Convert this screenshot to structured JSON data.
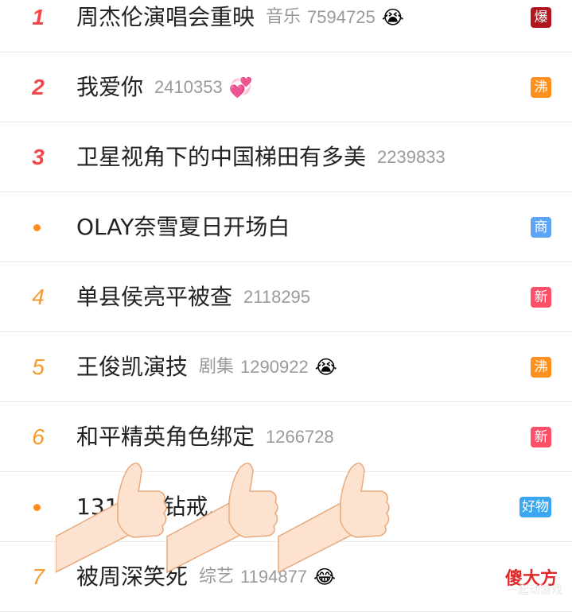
{
  "items": [
    {
      "rank": "1",
      "title": "周杰伦演唱会重映",
      "category": "音乐",
      "count": "7594725",
      "emoji": "😭",
      "badge": "爆",
      "badge_color": "#b2151d"
    },
    {
      "rank": "2",
      "title": "我爱你",
      "category": "",
      "count": "2410353",
      "emoji": "💞",
      "badge": "沸",
      "badge_color": "#ff8f1f"
    },
    {
      "rank": "3",
      "title": "卫星视角下的中国梯田有多美",
      "category": "",
      "count": "2239833",
      "emoji": "",
      "badge": "",
      "badge_color": ""
    },
    {
      "rank": "",
      "title": "OLAY奈雪夏日开场白",
      "category": "",
      "count": "",
      "emoji": "",
      "badge": "商",
      "badge_color": "#5ea4f5"
    },
    {
      "rank": "4",
      "title": "单县侯亮平被查",
      "category": "",
      "count": "2118295",
      "emoji": "",
      "badge": "新",
      "badge_color": "#ff4e6a"
    },
    {
      "rank": "5",
      "title": "王俊凯演技",
      "category": "剧集",
      "count": "1290922",
      "emoji": "😭",
      "badge": "沸",
      "badge_color": "#ff8f1f"
    },
    {
      "rank": "6",
      "title": "和平精英角色绑定",
      "category": "",
      "count": "1266728",
      "emoji": "",
      "badge": "新",
      "badge_color": "#ff4e6a"
    },
    {
      "rank": "",
      "title": "131…拉钻戒…够吗",
      "category": "",
      "count": "",
      "emoji": "",
      "badge": "好物",
      "badge_color": "#3ba7f0"
    },
    {
      "rank": "7",
      "title": "被周深笑死",
      "category": "综艺",
      "count": "1194877",
      "emoji": "😂",
      "badge": "",
      "badge_color": ""
    }
  ],
  "watermark": {
    "text": "傻大方",
    "sub": "一起动游戏"
  }
}
